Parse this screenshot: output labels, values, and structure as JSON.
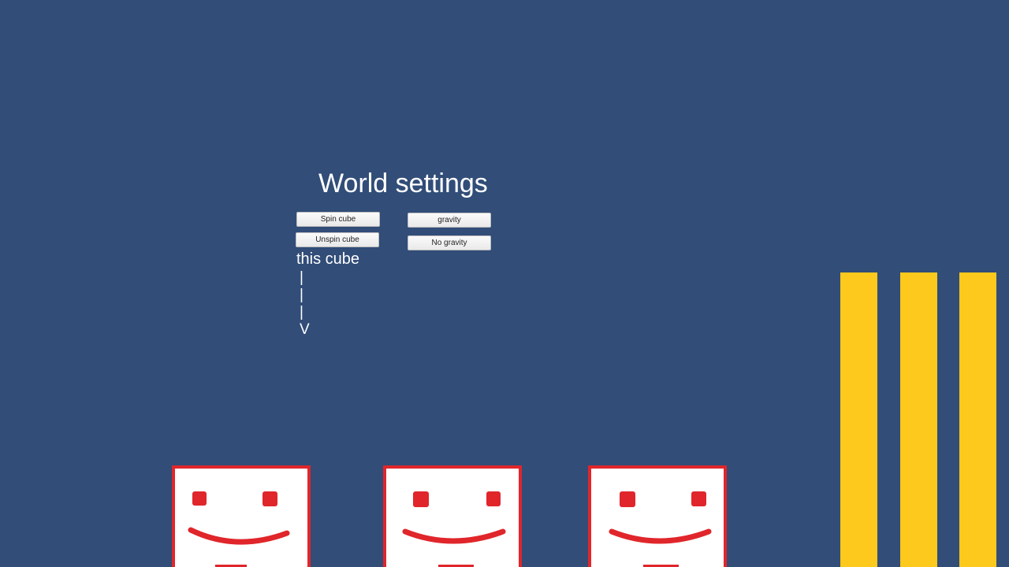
{
  "title": "World settings",
  "buttons": {
    "spin_cube": "Spin cube",
    "unspin_cube": "Unspin cube",
    "gravity": "gravity",
    "no_gravity": "No gravity"
  },
  "pointer": {
    "label": "this cube",
    "arrow_lines": [
      "|",
      "|",
      "|",
      "V"
    ]
  },
  "colors": {
    "background": "#314d78",
    "cube_face": "#ffffff",
    "cube_outline": "#e0262b",
    "stripes": "#fdc91c"
  },
  "cubes": [
    {
      "name": "smiley-cube-1"
    },
    {
      "name": "smiley-cube-2"
    },
    {
      "name": "smiley-cube-3"
    }
  ],
  "stripes": [
    {
      "name": "yellow-stripe-1"
    },
    {
      "name": "yellow-stripe-2"
    },
    {
      "name": "yellow-stripe-3"
    }
  ]
}
